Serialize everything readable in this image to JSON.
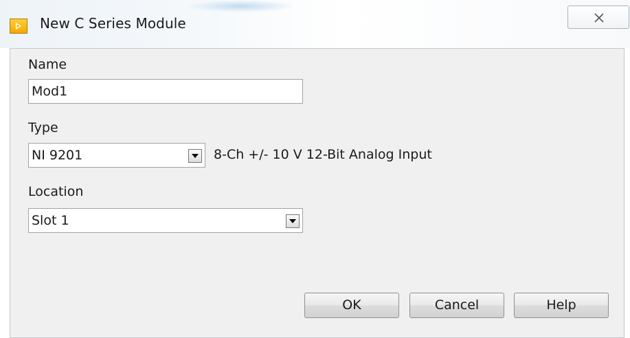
{
  "window": {
    "title": "New C Series Module",
    "icon": "labview-icon",
    "close_icon": "close-icon"
  },
  "form": {
    "name_label": "Name",
    "name_value": "Mod1",
    "type_label": "Type",
    "type_value": "NI 9201",
    "type_description": "8-Ch +/- 10 V 12-Bit Analog Input",
    "location_label": "Location",
    "location_value": "Slot 1"
  },
  "buttons": {
    "ok": "OK",
    "cancel": "Cancel",
    "help": "Help"
  },
  "colors": {
    "icon_yellow": "#f5b800",
    "dialog_background": "#f0f0f0"
  }
}
